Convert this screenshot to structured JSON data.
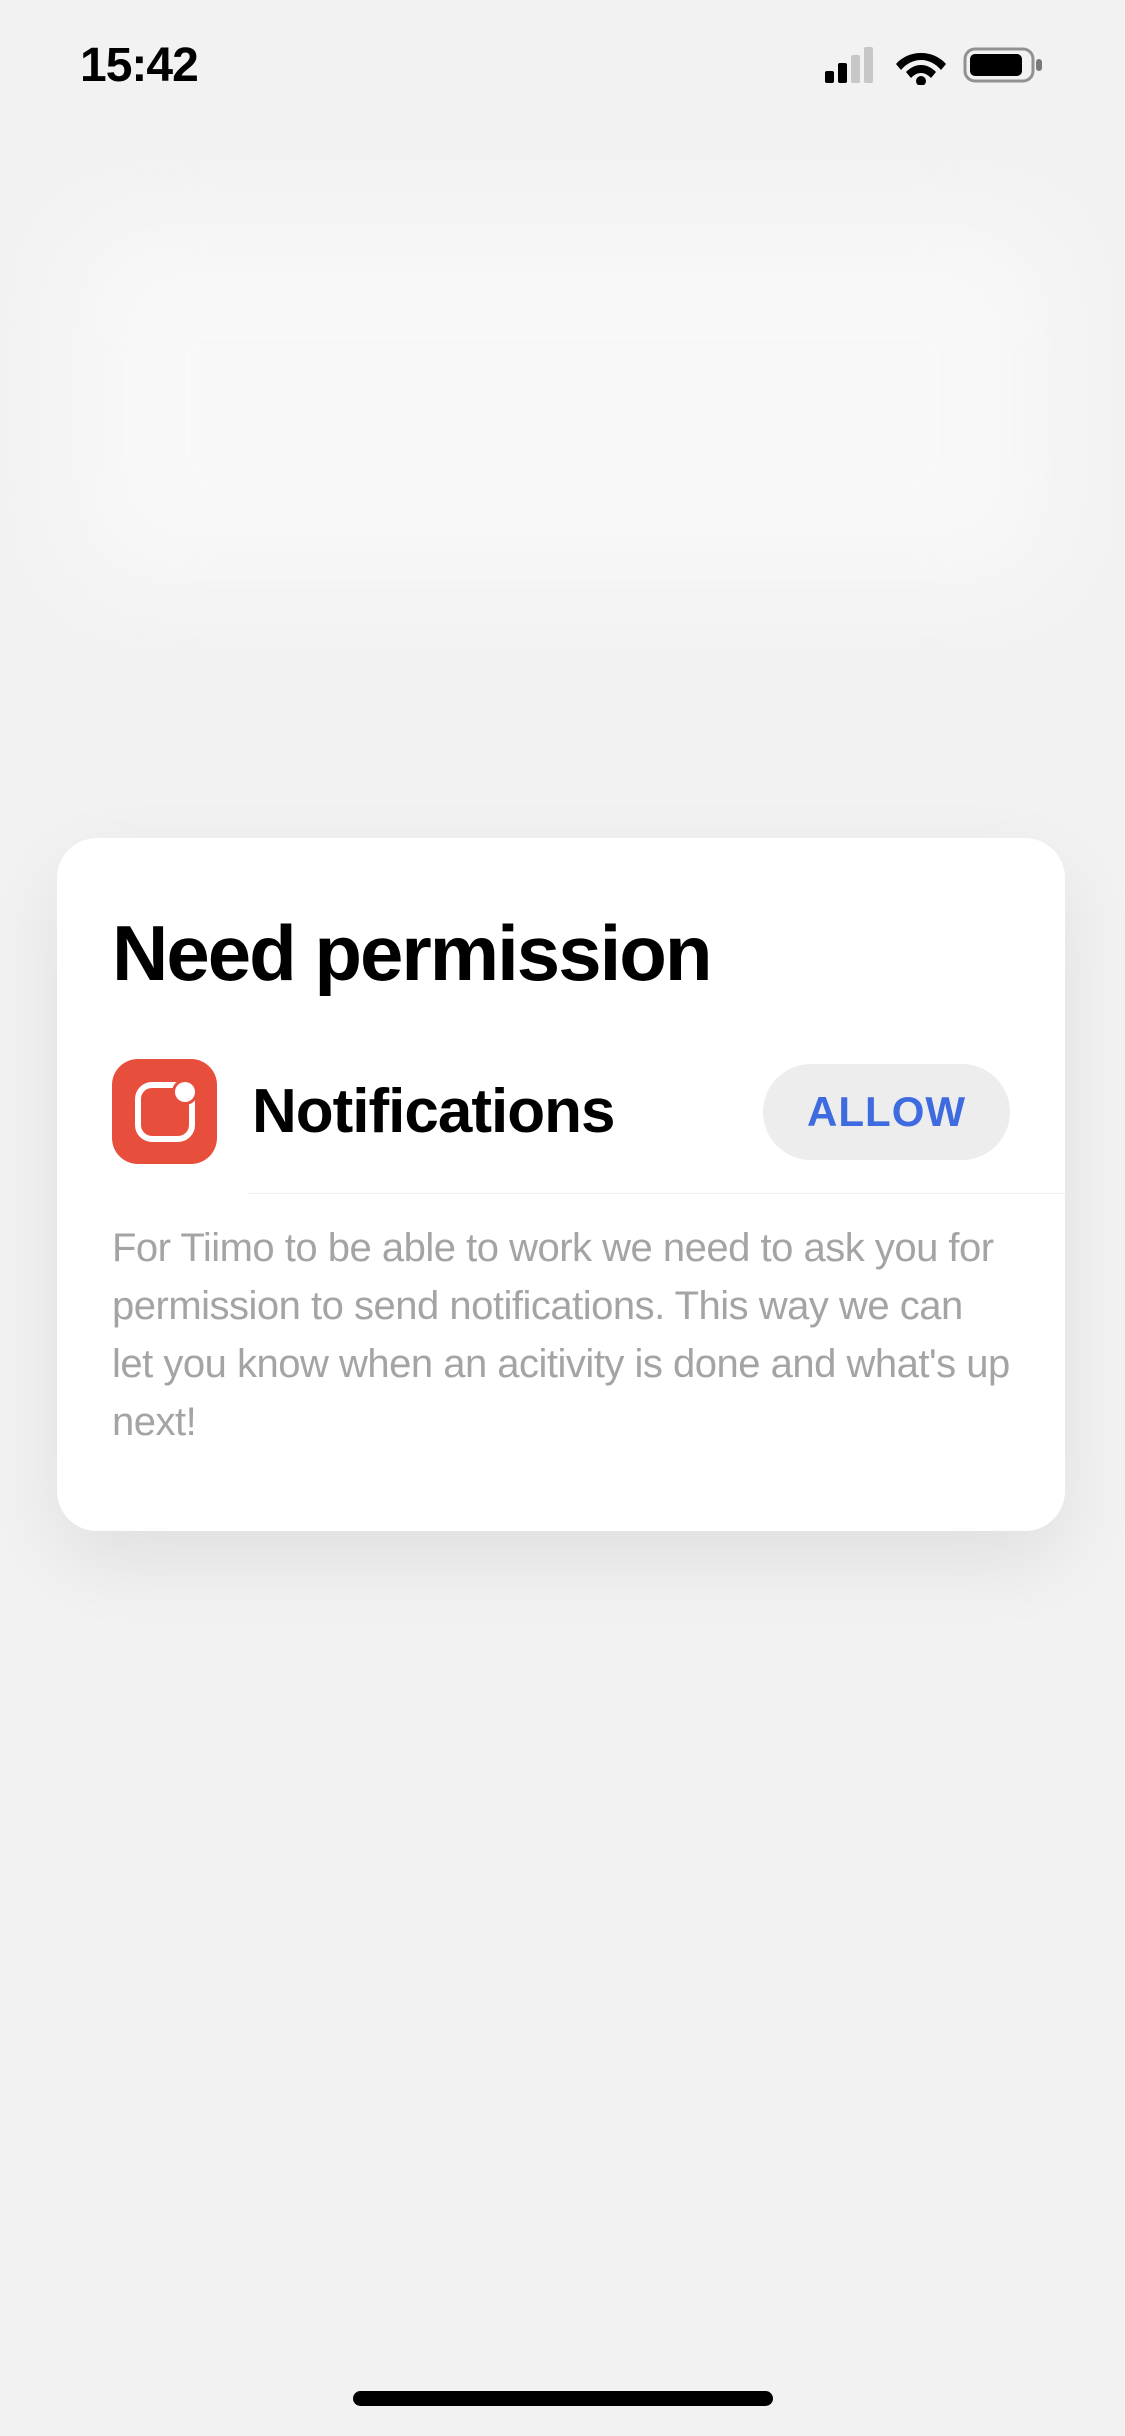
{
  "status_bar": {
    "time": "15:42"
  },
  "card": {
    "title": "Need permission",
    "permission": {
      "label": "Notifications",
      "button": "ALLOW",
      "icon_name": "notification-bell-icon"
    },
    "description": "For Tiimo to be able to work we need to ask you for permission to send notifications. This way we can let you know when an acitivity is done and what's up next!"
  },
  "colors": {
    "accent_red": "#e84e3c",
    "accent_blue": "#3f6be0",
    "button_bg": "#ededed",
    "text_muted": "#a4a4a4",
    "page_bg": "#f2f2f2"
  }
}
